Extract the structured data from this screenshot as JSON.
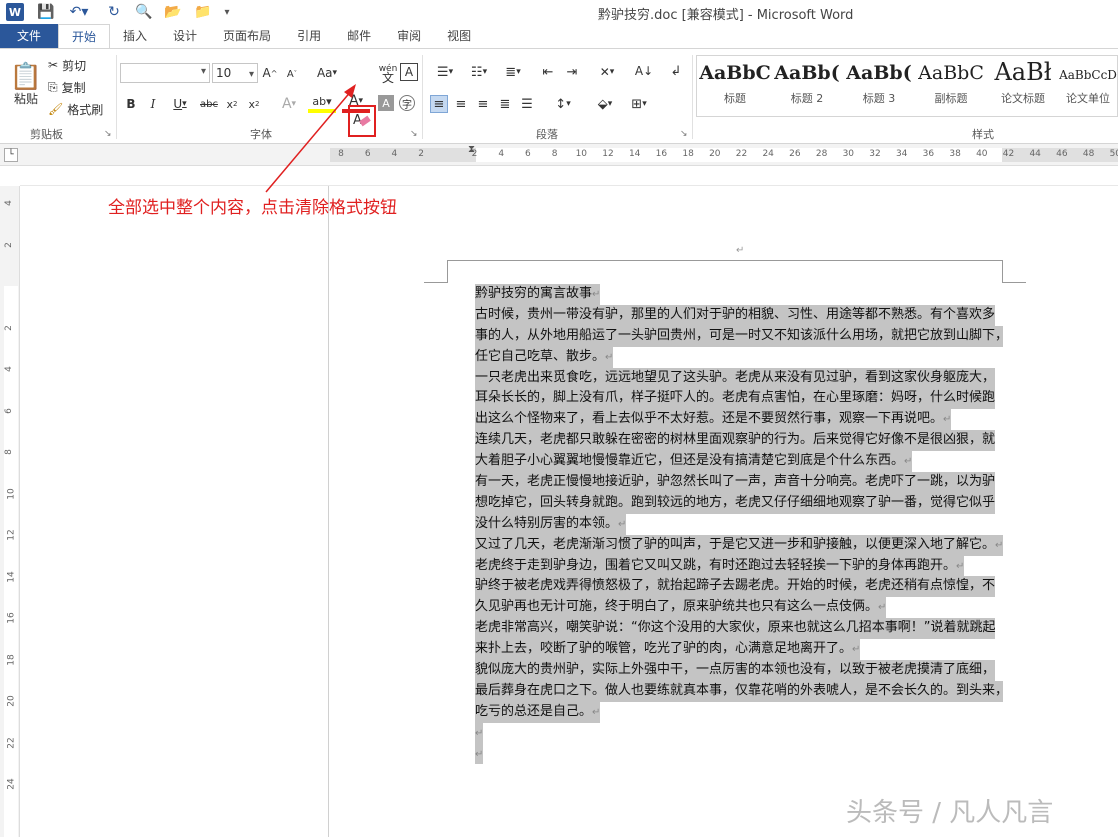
{
  "window": {
    "title": "黔驴技穷.doc [兼容模式] - Microsoft Word"
  },
  "quick_access": [
    "save-icon",
    "undo-icon",
    "redo-icon",
    "print-preview-icon",
    "open-icon",
    "customize-icon"
  ],
  "tabs": [
    {
      "label": "文件"
    },
    {
      "label": "开始"
    },
    {
      "label": "插入"
    },
    {
      "label": "设计"
    },
    {
      "label": "页面布局"
    },
    {
      "label": "引用"
    },
    {
      "label": "邮件"
    },
    {
      "label": "审阅"
    },
    {
      "label": "视图"
    }
  ],
  "clipboard": {
    "paste": "粘贴",
    "cut": "剪切",
    "copy": "复制",
    "format_painter": "格式刷",
    "group": "剪贴板"
  },
  "font": {
    "name": "",
    "size": "10",
    "group": "字体",
    "change_case": "Aa"
  },
  "paragraph": {
    "group": "段落"
  },
  "styles": {
    "group": "样式",
    "items": [
      {
        "sample": "AaBbC",
        "name": "标题"
      },
      {
        "sample": "AaBb(",
        "name": "标题 2"
      },
      {
        "sample": "AaBb(",
        "name": "标题 3"
      },
      {
        "sample": "AaBbC",
        "name": "副标题"
      },
      {
        "sample": "AaBł",
        "name": "论文标题"
      },
      {
        "sample": "AaBbCcD",
        "name": "论文单位"
      }
    ]
  },
  "ruler_ticks": [
    "8",
    "6",
    "4",
    "2",
    "",
    "2",
    "4",
    "6",
    "8",
    "10",
    "12",
    "14",
    "16",
    "18",
    "20",
    "22",
    "24",
    "26",
    "28",
    "30",
    "32",
    "34",
    "36",
    "38",
    "40",
    "42",
    "44",
    "46",
    "48",
    "50"
  ],
  "vruler_ticks": [
    "4",
    "2",
    "",
    "2",
    "4",
    "6",
    "8",
    "10",
    "12",
    "14",
    "16",
    "18",
    "20",
    "22",
    "24"
  ],
  "annotation": "全部选中整个内容，点击清除格式按钮",
  "paragraph_mark": "↵",
  "document_lines": [
    "黔驴技穷的寓言故事",
    "古时候，贵州一带没有驴，那里的人们对于驴的相貌、习性、用途等都不熟悉。有个喜欢多",
    "事的人，从外地用船运了一头驴回贵州，可是一时又不知该派什么用场，就把它放到山脚下，",
    "任它自己吃草、散步。",
    "一只老虎出来觅食吃，远远地望见了这头驴。老虎从来没有见过驴，看到这家伙身躯庞大，",
    "耳朵长长的，脚上没有爪，样子挺吓人的。老虎有点害怕，在心里琢磨：妈呀，什么时候跑",
    "出这么个怪物来了，看上去似乎不太好惹。还是不要贸然行事，观察一下再说吧。",
    "连续几天，老虎都只敢躲在密密的树林里面观察驴的行为。后来觉得它好像不是很凶狠，就",
    "大着胆子小心翼翼地慢慢靠近它，但还是没有搞清楚它到底是个什么东西。",
    "有一天，老虎正慢慢地接近驴，驴忽然长叫了一声，声音十分响亮。老虎吓了一跳，以为驴",
    "想吃掉它，回头转身就跑。跑到较远的地方，老虎又仔仔细细地观察了驴一番，觉得它似乎",
    "没什么特别厉害的本领。",
    "又过了几天，老虎渐渐习惯了驴的叫声，于是它又进一步和驴接触，以便更深入地了解它。",
    "老虎终于走到驴身边，围着它又叫又跳，有时还跑过去轻轻挨一下驴的身体再跑开。",
    "驴终于被老虎戏弄得愤怒极了，就抬起蹄子去踢老虎。开始的时候，老虎还稍有点惊惶，不",
    "久见驴再也无计可施，终于明白了，原来驴统共也只有这么一点伎俩。",
    "老虎非常高兴，嘲笑驴说：“你这个没用的大家伙，原来也就这么几招本事啊！”说着就跳起",
    "来扑上去，咬断了驴的喉管，吃光了驴的肉，心满意足地离开了。",
    "貌似庞大的贵州驴，实际上外强中干，一点厉害的本领也没有，以致于被老虎摸清了底细，",
    "最后葬身在虎口之下。做人也要练就真本事，仅靠花哨的外表唬人，是不会长久的。到头来，",
    "吃亏的总还是自己。",
    "",
    ""
  ],
  "paragraph_end_lines": [
    0,
    3,
    6,
    8,
    11,
    12,
    13,
    15,
    17,
    20,
    21,
    22
  ],
  "watermark": "头条号 / 凡人凡言"
}
